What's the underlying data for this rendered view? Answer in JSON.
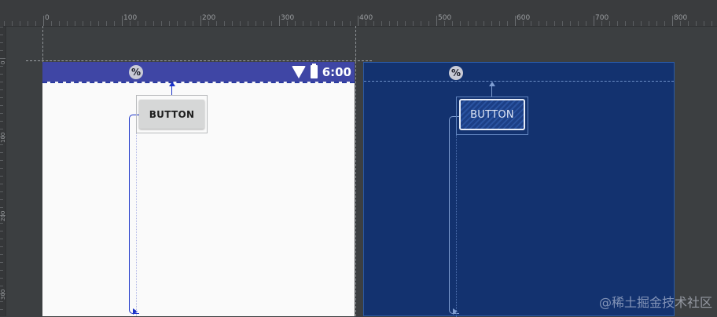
{
  "ruler": {
    "labels": [
      "0",
      "100",
      "200",
      "300",
      "400",
      "500",
      "600",
      "700",
      "800"
    ],
    "left_labels": [
      "0",
      "100",
      "200",
      "300"
    ]
  },
  "design": {
    "statusbar": {
      "percent_icon": "%",
      "wifi_icon": "wifi-icon",
      "battery_icon": "battery-icon",
      "time": "6:00"
    },
    "button_label": "BUTTON"
  },
  "blueprint": {
    "percent_icon": "%",
    "button_label": "BUTTON"
  },
  "watermark": "@稀土掘金技术社区",
  "colors": {
    "background": "#3c3f41",
    "statusbar": "#3f46a5",
    "blueprint": "#13326f",
    "constraint": "#1b33c8"
  }
}
